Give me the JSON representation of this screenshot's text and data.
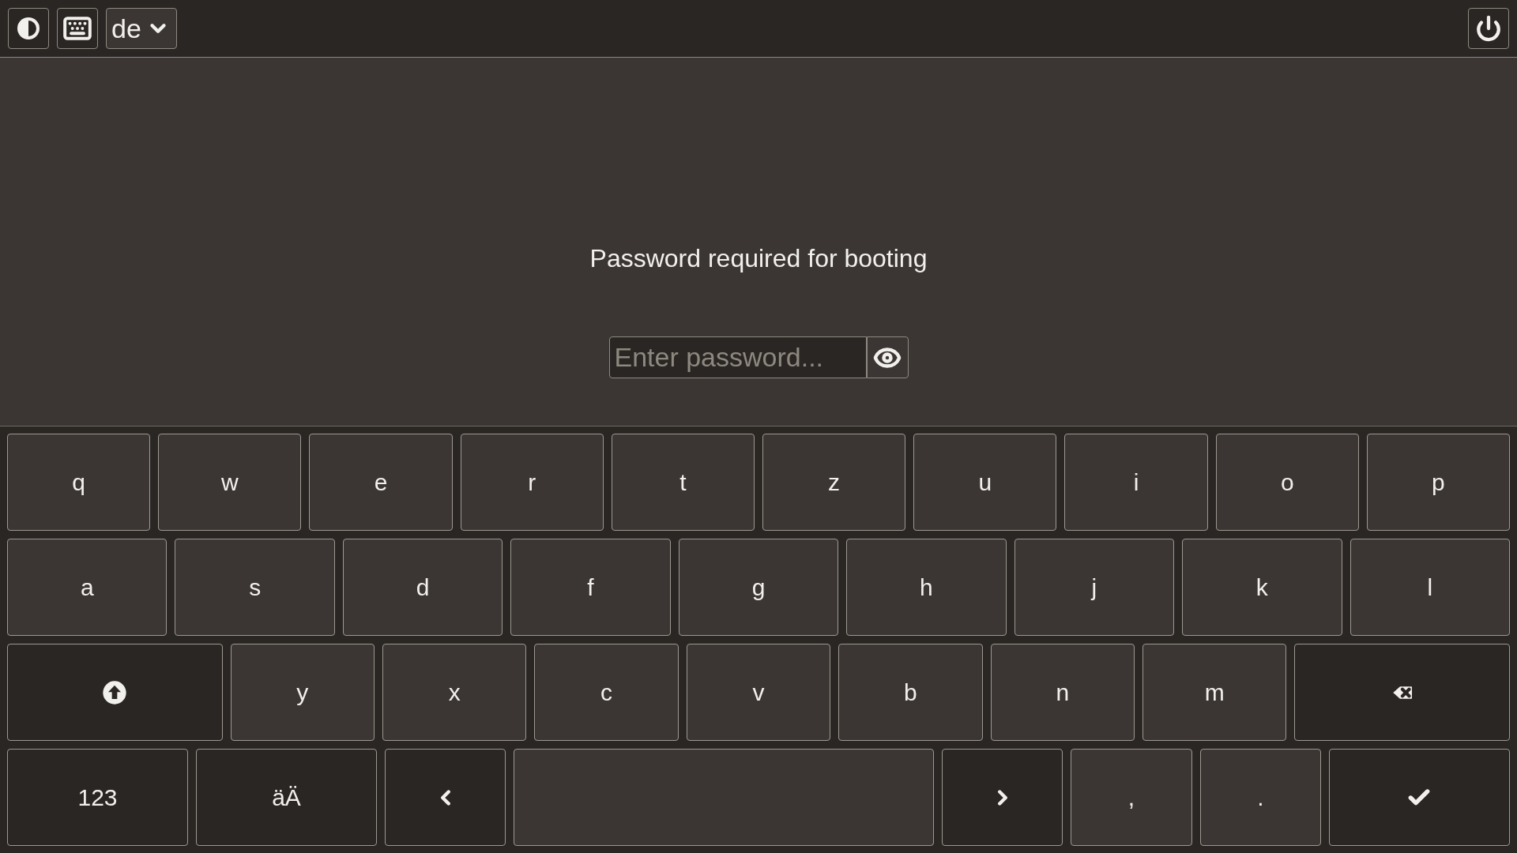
{
  "top_bar": {
    "language": "de"
  },
  "prompt": {
    "message": "Password required for booting",
    "placeholder": "Enter password..."
  },
  "keyboard": {
    "rows": [
      [
        {
          "kind": "char",
          "label": "q"
        },
        {
          "kind": "char",
          "label": "w"
        },
        {
          "kind": "char",
          "label": "e"
        },
        {
          "kind": "char",
          "label": "r"
        },
        {
          "kind": "char",
          "label": "t"
        },
        {
          "kind": "char",
          "label": "z"
        },
        {
          "kind": "char",
          "label": "u"
        },
        {
          "kind": "char",
          "label": "i"
        },
        {
          "kind": "char",
          "label": "o"
        },
        {
          "kind": "char",
          "label": "p"
        }
      ],
      [
        {
          "kind": "char",
          "label": "a"
        },
        {
          "kind": "char",
          "label": "s"
        },
        {
          "kind": "char",
          "label": "d"
        },
        {
          "kind": "char",
          "label": "f"
        },
        {
          "kind": "char",
          "label": "g"
        },
        {
          "kind": "char",
          "label": "h"
        },
        {
          "kind": "char",
          "label": "j"
        },
        {
          "kind": "char",
          "label": "k"
        },
        {
          "kind": "char",
          "label": "l"
        }
      ],
      [
        {
          "kind": "shift"
        },
        {
          "kind": "char",
          "label": "y"
        },
        {
          "kind": "char",
          "label": "x"
        },
        {
          "kind": "char",
          "label": "c"
        },
        {
          "kind": "char",
          "label": "v"
        },
        {
          "kind": "char",
          "label": "b"
        },
        {
          "kind": "char",
          "label": "n"
        },
        {
          "kind": "char",
          "label": "m"
        },
        {
          "kind": "backspace"
        }
      ],
      [
        {
          "kind": "mode",
          "label": "123"
        },
        {
          "kind": "mode",
          "label": "äÄ"
        },
        {
          "kind": "left"
        },
        {
          "kind": "space"
        },
        {
          "kind": "right"
        },
        {
          "kind": "char",
          "label": ","
        },
        {
          "kind": "char",
          "label": "."
        },
        {
          "kind": "enter"
        }
      ]
    ]
  }
}
